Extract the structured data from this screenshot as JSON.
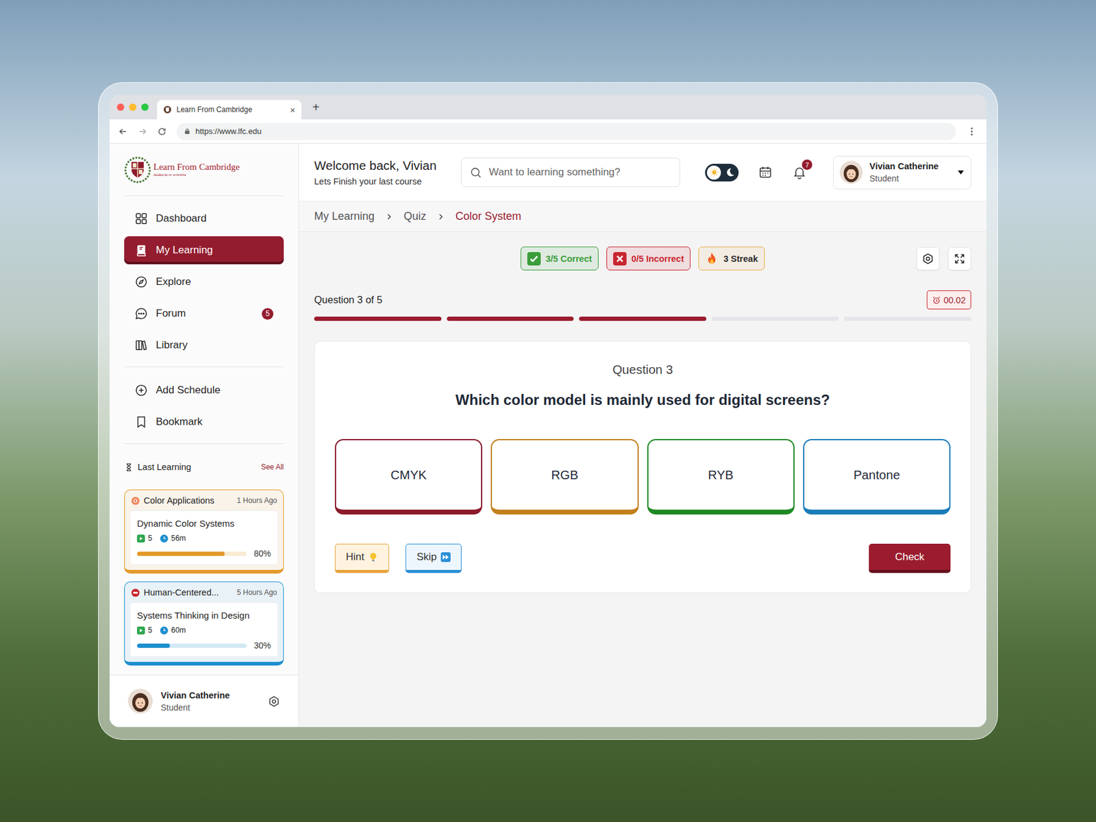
{
  "browser": {
    "tab_title": "Learn From Cambridge",
    "tab_close": "×",
    "new_tab": "+",
    "url": "https://www.lfc.edu"
  },
  "logo": {
    "name": "Learn From Cambridge",
    "motto": "Audacia et scientia"
  },
  "sidebar": {
    "items": [
      {
        "label": "Dashboard",
        "selected": false,
        "badge": ""
      },
      {
        "label": "My Learning",
        "selected": true,
        "badge": ""
      },
      {
        "label": "Explore",
        "selected": false,
        "badge": ""
      },
      {
        "label": "Forum",
        "selected": false,
        "badge": "5"
      },
      {
        "label": "Library",
        "selected": false,
        "badge": ""
      }
    ],
    "secondary_items": [
      {
        "label": "Add Schedule",
        "selected": false
      },
      {
        "label": "Bookmark",
        "selected": false
      }
    ],
    "last_learning": {
      "title": "Last Learning",
      "see_all": "See All",
      "cards": [
        {
          "category": "Color Applications",
          "time": "1 Hours Ago",
          "course": "Dynamic Color Systems",
          "lessons": "5",
          "duration": "56m",
          "level": 0.8,
          "percent": "80%",
          "color": "#e39a2a"
        },
        {
          "category": "Human-Centered...",
          "time": "5 Hours Ago",
          "course": "Systems Thinking in Design",
          "lessons": "5",
          "duration": "60m",
          "level": 0.3,
          "percent": "30%",
          "color": "#1e8fce"
        }
      ]
    },
    "profile": {
      "name": "Vivian Catherine",
      "role": "Student"
    }
  },
  "header": {
    "welcome": "Welcome back, Vivian",
    "subtitle": "Lets Finish your last course",
    "search_placeholder": "Want to learning something?",
    "dark_mode": false,
    "notifications": "7",
    "user": {
      "name": "Vivian Catherine",
      "role": "Student"
    }
  },
  "breadcrumb": [
    {
      "label": "My Learning",
      "selected": false
    },
    {
      "label": "Quiz",
      "selected": false
    },
    {
      "label": "Color System",
      "selected": true
    }
  ],
  "stats": [
    {
      "label": "3/5 Correct",
      "kind": "correct",
      "color": "#3a9d3a"
    },
    {
      "label": "0/5 Incorrect",
      "kind": "incorrect",
      "color": "#c8262f"
    },
    {
      "label": "3 Streak",
      "kind": "streak",
      "color": "#eab04a"
    }
  ],
  "quiz": {
    "progress_label": "Question 3 of 5",
    "timer": "00.02",
    "steps": [
      {
        "done": true
      },
      {
        "done": true
      },
      {
        "done": true
      },
      {
        "done": false
      },
      {
        "done": false
      }
    ],
    "question_number": "Question 3",
    "question": "Which color model is mainly used for digital screens?",
    "options": [
      {
        "label": "CMYK",
        "selected": false,
        "color": "#8b1a2b"
      },
      {
        "label": "RGB",
        "selected": false,
        "color": "#c2811c"
      },
      {
        "label": "RYB",
        "selected": false,
        "color": "#1f8a24"
      },
      {
        "label": "Pantone",
        "selected": false,
        "color": "#1a7cb9"
      }
    ],
    "hint": "Hint",
    "skip": "Skip",
    "check": "Check"
  }
}
